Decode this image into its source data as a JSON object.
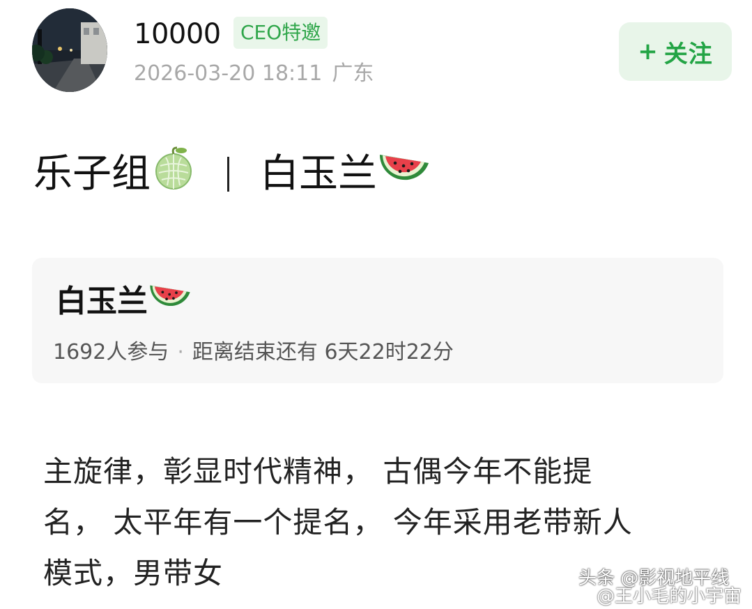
{
  "header": {
    "avatar_icon": "avatar-night-street-photo",
    "username": "10000",
    "badge": "CEO特邀",
    "timestamp": "2026-03-20 18:11",
    "location": "广东",
    "follow_label": "关注",
    "follow_plus": "+"
  },
  "post": {
    "title_left": "乐子组",
    "title_right": "白玉兰",
    "title_icons": [
      "melon-icon",
      "watermelon-icon"
    ]
  },
  "topic_card": {
    "name": "白玉兰",
    "name_icon": "watermelon-icon",
    "participants": "1692人参与",
    "separator": "·",
    "countdown": "距离结束还有 6天22时22分"
  },
  "body": {
    "lines": [
      "主旋律，彰显时代精神， 古偶今年不能提",
      "名， 太平年有一个提名， 今年采用老带新人",
      "模式，男带女"
    ]
  },
  "watermark": {
    "line1": "头条 @影视地平线",
    "line2": "@王小毛的小宇宙",
    "icon": "weibo-icon"
  },
  "colors": {
    "accent_green": "#23a445",
    "badge_bg": "#e9f6ea",
    "follow_bg": "#e8f5e9",
    "meta_gray": "#a8a8a8",
    "card_bg": "#f7f7f7"
  }
}
